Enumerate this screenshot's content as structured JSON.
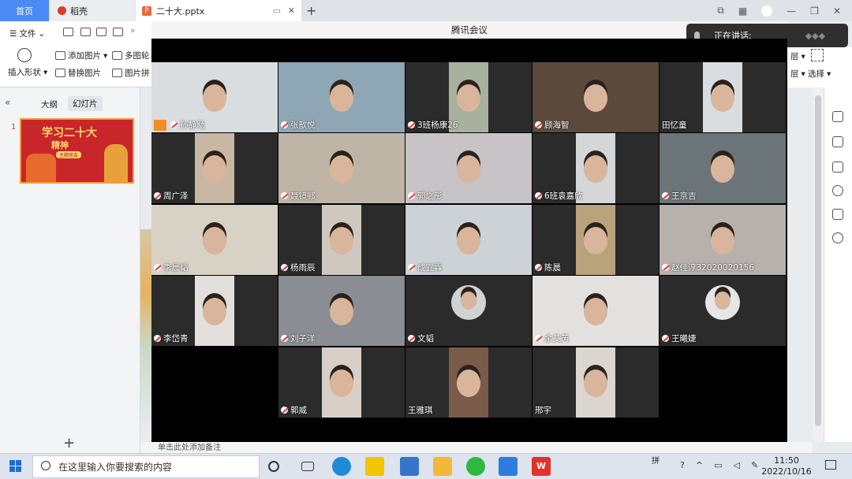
{
  "tabs": {
    "home": "首页",
    "daoke": "稻壳",
    "file": "二十大.pptx",
    "add": "+"
  },
  "ribbon": {
    "menu_file": "文件",
    "add_image": "添加图片",
    "multi_image": "多图轮",
    "insert_shape": "插入形状",
    "replace_image": "替换图片",
    "image_puzzle": "图片拼",
    "layer1": "层",
    "layer2": "层",
    "select": "选择"
  },
  "panel": {
    "outline_tab": "大纲",
    "slides_tab": "幻灯片",
    "slide_number": "1"
  },
  "slide_thumb": {
    "title": "学习二十大",
    "subtitle": "精神",
    "tag": "主题班会"
  },
  "meeting": {
    "app_title": "腾讯会议",
    "speaking_label": "正在讲话:",
    "participants": [
      {
        "name": "孙静飏",
        "muted": false,
        "host": true
      },
      {
        "name": "张歆悦",
        "muted": true
      },
      {
        "name": "3班杨康26",
        "muted": true
      },
      {
        "name": "顾海智",
        "muted": true
      },
      {
        "name": "田忆童",
        "muted": false
      },
      {
        "name": "周广泽",
        "muted": true
      },
      {
        "name": "聂镜郦",
        "muted": true
      },
      {
        "name": "郭之彤",
        "muted": true
      },
      {
        "name": "6班袁嘉欣",
        "muted": true
      },
      {
        "name": "王京吉",
        "muted": true
      },
      {
        "name": "李晨韬",
        "muted": true
      },
      {
        "name": "杨雨辰",
        "muted": true
      },
      {
        "name": "成宜霖",
        "muted": true
      },
      {
        "name": "陈晨",
        "muted": true
      },
      {
        "name": "赵佳淳32020020156",
        "muted": true
      },
      {
        "name": "李岱青",
        "muted": true
      },
      {
        "name": "刘子洋",
        "muted": true
      },
      {
        "name": "文韬",
        "muted": true
      },
      {
        "name": "余艾芮",
        "muted": true
      },
      {
        "name": "王曦婕",
        "muted": true
      },
      {
        "name": "郭威",
        "muted": true
      },
      {
        "name": "王雅琪",
        "muted": false
      },
      {
        "name": "邢宇",
        "muted": false
      }
    ]
  },
  "notes_placeholder": "单击此处添加备注",
  "taskbar": {
    "search_placeholder": "在这里输入你要搜索的内容",
    "time": "11:50",
    "date": "2022/10/16",
    "ime": "拼"
  },
  "colors": {
    "accent": "#4a8af4",
    "wps_red": "#e03a2b",
    "meeting_bg": "#000000"
  }
}
